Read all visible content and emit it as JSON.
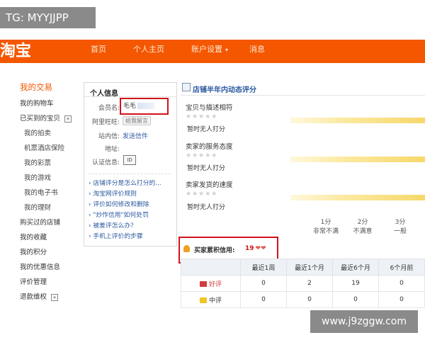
{
  "overlay": {
    "tg": "TG: MYYJJPP",
    "watermark": "www.j9zggw.com"
  },
  "topnav": {
    "logo": "淘宝",
    "items": [
      "首页",
      "个人主页",
      "账户设置",
      "消息"
    ],
    "accent": "#f45700"
  },
  "sidebar": {
    "header": "我的交易",
    "items": [
      "我的购物车",
      "已买到的宝贝",
      "我的拍卖",
      "机票酒店保险",
      "我的彩票",
      "我的游戏",
      "我的电子书",
      "我的理财",
      "购买过的店铺",
      "我的收藏",
      "我的积分",
      "我的优惠信息",
      "评价管理",
      "退款维权"
    ]
  },
  "info": {
    "title": "个人信息",
    "member_label": "会员名:",
    "member_value": "毛毛",
    "wangwang_label": "阿里旺旺:",
    "wangwang_value": "给我留言",
    "letter_label": "站内信:",
    "letter_value": "发送信件",
    "address_label": "地址:",
    "cert_label": "认证信息:",
    "faq": [
      "店铺评分是怎么打分的...",
      "淘宝网评价规则",
      "评价如何修改和删除",
      "\"炒作信用\"如何处罚",
      "被差评怎么办？",
      "手机上评价的步骤"
    ]
  },
  "dynamic": {
    "title": "店铺半年内动态评分",
    "items": [
      {
        "label": "宝贝与描述相符",
        "note": "暂时无人打分"
      },
      {
        "label": "卖家的服务态度",
        "note": "暂时无人打分"
      },
      {
        "label": "卖家发货的速度",
        "note": "暂时无人打分"
      }
    ],
    "stars": "★★★★★",
    "scale": [
      {
        "score": "1分",
        "desc": "非常不满"
      },
      {
        "score": "2分",
        "desc": "不满意"
      },
      {
        "score": "3分",
        "desc": "一般"
      }
    ]
  },
  "credit": {
    "label": "买家累积信用:",
    "value": "19",
    "hearts": "❤❤"
  },
  "table": {
    "headers": [
      "",
      "最近1周",
      "最近1个月",
      "最近6个月",
      "6个月前"
    ],
    "rows": [
      {
        "label": "好评",
        "values": [
          "0",
          "2",
          "19",
          "0"
        ]
      },
      {
        "label": "中评",
        "values": [
          "0",
          "0",
          "0",
          "0"
        ]
      }
    ]
  }
}
